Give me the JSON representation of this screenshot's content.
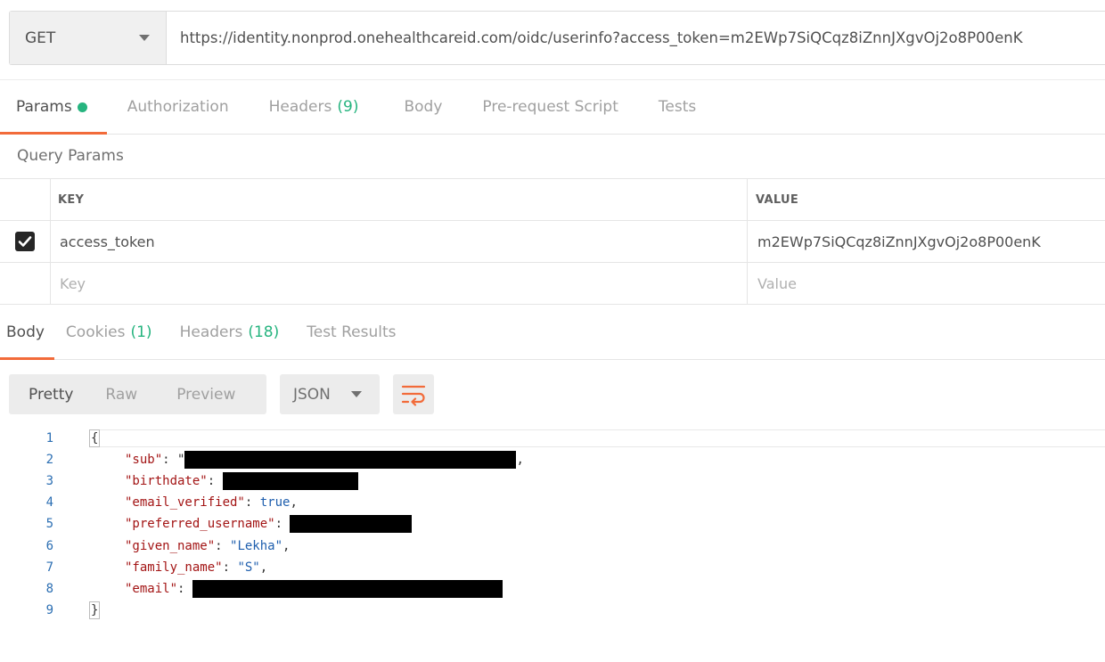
{
  "request": {
    "method": "GET",
    "url": "https://identity.nonprod.onehealthcareid.com/oidc/userinfo?access_token=m2EWp7SiQCqz8iZnnJXgvOj2o8P00enK"
  },
  "request_tabs": [
    {
      "label": "Params",
      "count": ""
    },
    {
      "label": "Authorization",
      "count": ""
    },
    {
      "label": "Headers",
      "count": "(9)"
    },
    {
      "label": "Body",
      "count": ""
    },
    {
      "label": "Pre-request Script",
      "count": ""
    },
    {
      "label": "Tests",
      "count": ""
    }
  ],
  "query_params": {
    "title": "Query Params",
    "headers": {
      "key": "KEY",
      "value": "VALUE"
    },
    "rows": [
      {
        "key": "access_token",
        "value": "m2EWp7SiQCqz8iZnnJXgvOj2o8P00enK",
        "checked": true
      }
    ],
    "placeholders": {
      "key": "Key",
      "value": "Value"
    }
  },
  "response_tabs": [
    {
      "label": "Body",
      "count": ""
    },
    {
      "label": "Cookies",
      "count": "(1)"
    },
    {
      "label": "Headers",
      "count": "(18)"
    },
    {
      "label": "Test Results",
      "count": ""
    }
  ],
  "toolbar": {
    "views": [
      "Pretty",
      "Raw",
      "Preview"
    ],
    "format": "JSON",
    "wrap_icon": "wrap-lines-icon"
  },
  "response_body": {
    "line_numbers": [
      "1",
      "2",
      "3",
      "4",
      "5",
      "6",
      "7",
      "8",
      "9"
    ],
    "open_brace": "{",
    "close_brace": "}",
    "fields": [
      {
        "key": "\"sub\"",
        "value": "",
        "redacted": true
      },
      {
        "key": "\"birthdate\"",
        "value": "",
        "redacted": true
      },
      {
        "key": "\"email_verified\"",
        "value": "true",
        "redacted": false
      },
      {
        "key": "\"preferred_username\"",
        "value": "",
        "redacted": true
      },
      {
        "key": "\"given_name\"",
        "value": "\"Lekha\"",
        "redacted": false
      },
      {
        "key": "\"family_name\"",
        "value": "\"S\"",
        "redacted": false
      },
      {
        "key": "\"email\"",
        "value": "",
        "redacted": true
      }
    ]
  },
  "colors": {
    "accent": "#f26b3a",
    "count_green": "#26b47f",
    "json_key": "#a31515",
    "json_value": "#1f5fae"
  }
}
